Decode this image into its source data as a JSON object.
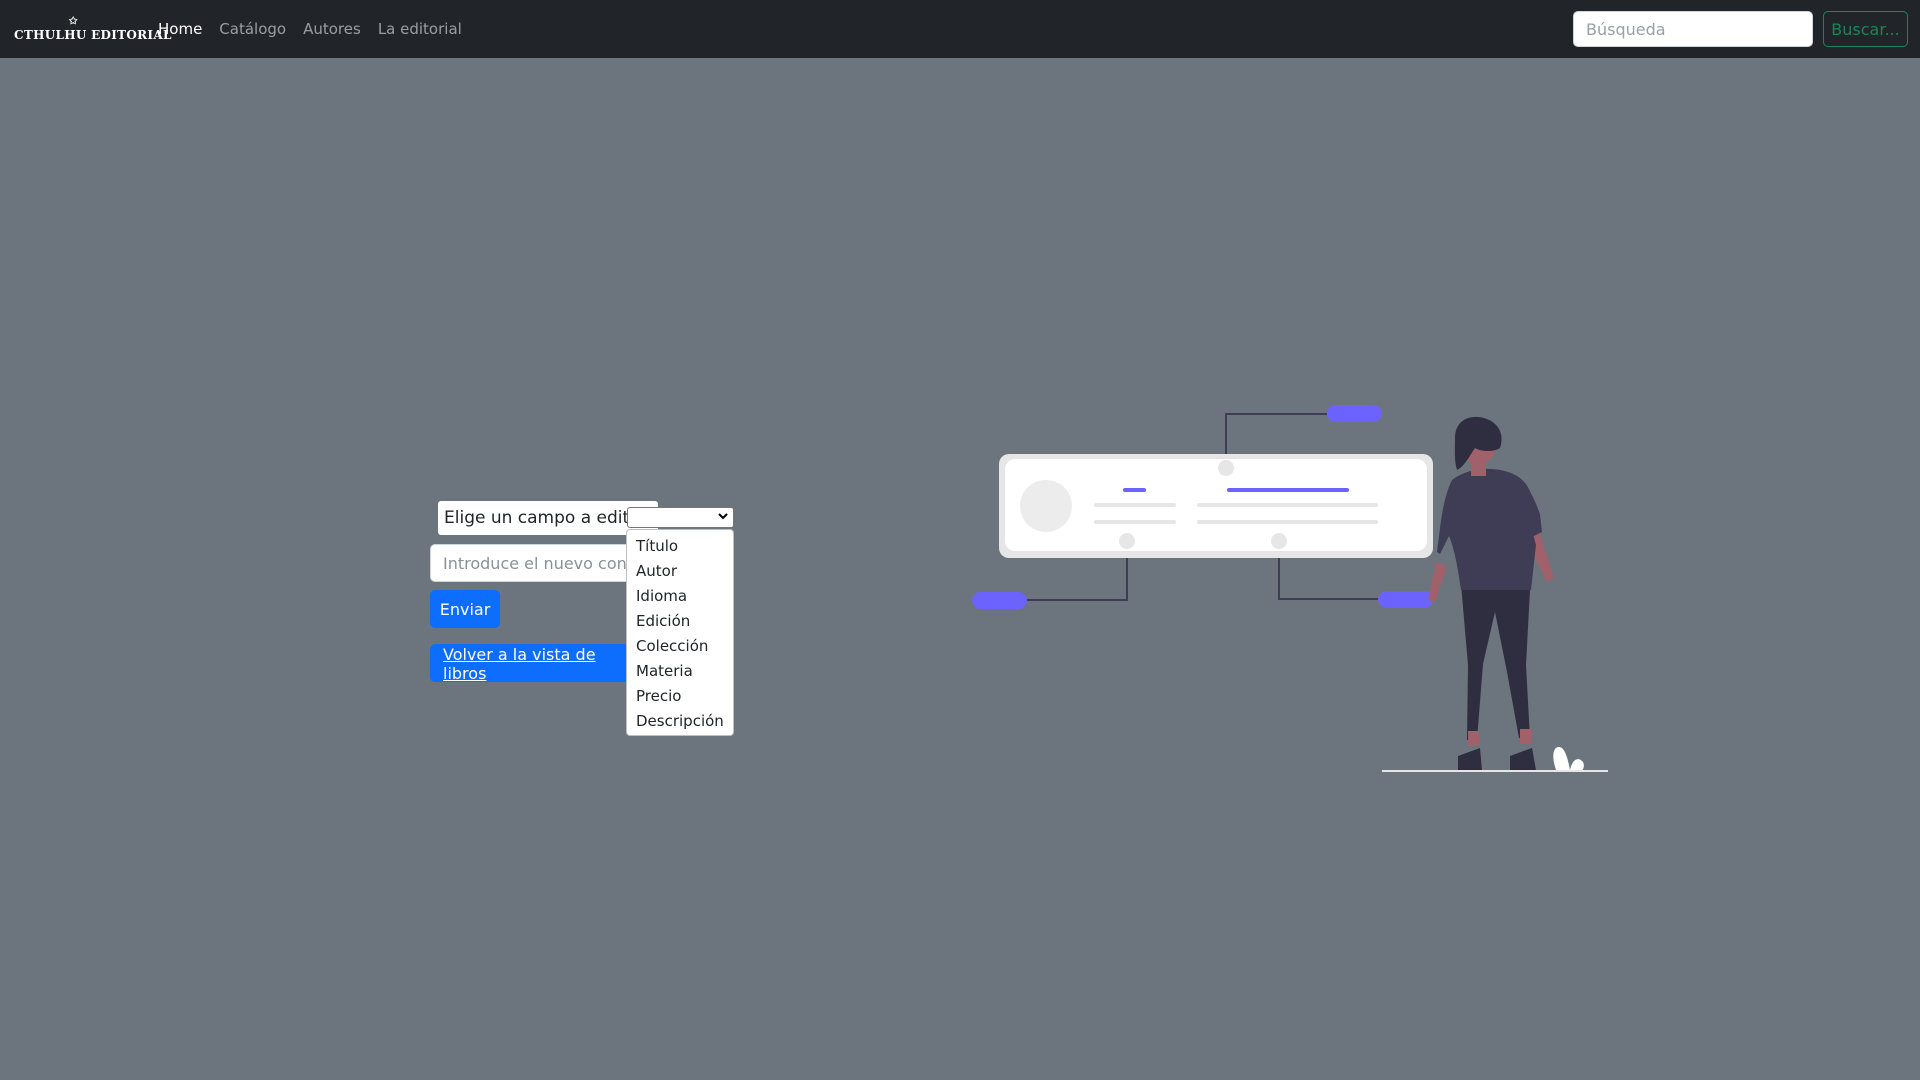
{
  "navbar": {
    "brand": "CTHULHU EDITORIAL",
    "links": [
      {
        "label": "Home",
        "active": true
      },
      {
        "label": "Catálogo",
        "active": false
      },
      {
        "label": "Autores",
        "active": false
      },
      {
        "label": "La editorial",
        "active": false
      }
    ],
    "search_placeholder": "Búsqueda",
    "search_button": "Buscar..."
  },
  "form": {
    "field_label": "Elige un campo a editar:",
    "selected_value": "",
    "content_placeholder": "Introduce el nuevo contenido",
    "submit_label": "Enviar",
    "back_label": "Volver a la vista de libros"
  },
  "dropdown": {
    "options": [
      "Título",
      "Autor",
      "Idioma",
      "Edición",
      "Colección",
      "Materia",
      "Precio",
      "Descripción"
    ]
  },
  "colors": {
    "background": "#6c757d",
    "navbar": "#212529",
    "primary": "#0d6efd",
    "success": "#198754",
    "illustration_accent": "#6c63ff",
    "illustration_figure": "#3f3d56"
  }
}
